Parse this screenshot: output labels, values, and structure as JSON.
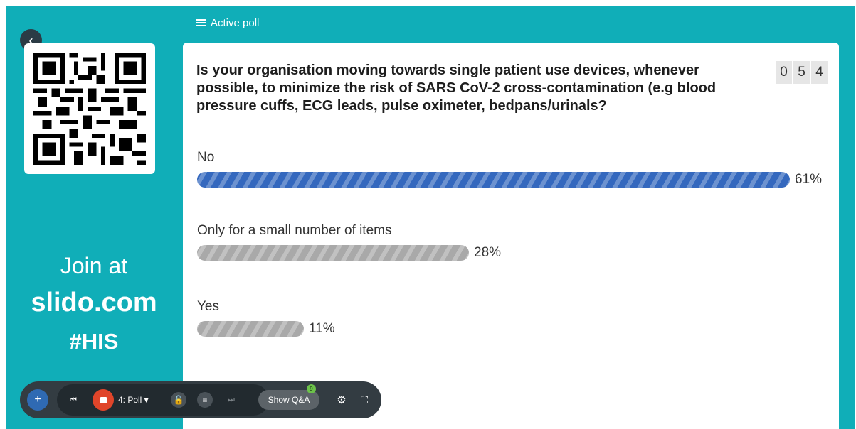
{
  "sidebar": {
    "back_label": "‹",
    "join_line1": "Join at",
    "join_url": "slido.com",
    "join_code": "#HIS"
  },
  "header": {
    "active_label": "Active poll"
  },
  "poll": {
    "question": "Is your organisation moving towards single patient use devices, whenever possible, to minimize the risk of SARS CoV-2 cross-contamination (e.g blood pressure cuffs, ECG leads, pulse oximeter, bedpans/urinals?",
    "participants_digits": [
      "0",
      "5",
      "4"
    ],
    "options": [
      {
        "label": "No",
        "percent_label": "61%",
        "percent": 61,
        "color": "#3468be"
      },
      {
        "label": "Only for a small number of items",
        "percent_label": "28%",
        "percent": 28,
        "color": "#a9a9a9"
      },
      {
        "label": "Yes",
        "percent_label": "11%",
        "percent": 11,
        "color": "#a9a9a9"
      }
    ]
  },
  "toolbar": {
    "add_label": "+",
    "prev_label": "⏮",
    "poll_selector_label": "4: Poll ▾",
    "lock_label": "🔓",
    "results_label": "≡",
    "next_label": "⏭",
    "show_qa_label": "Show Q&A",
    "qa_badge": "9",
    "settings_label": "⚙",
    "fullscreen_label": "⛶"
  },
  "colors": {
    "background": "#10aeb8",
    "primary_bar": "#3468be",
    "secondary_bar": "#a9a9a9",
    "record": "#e0452a"
  }
}
